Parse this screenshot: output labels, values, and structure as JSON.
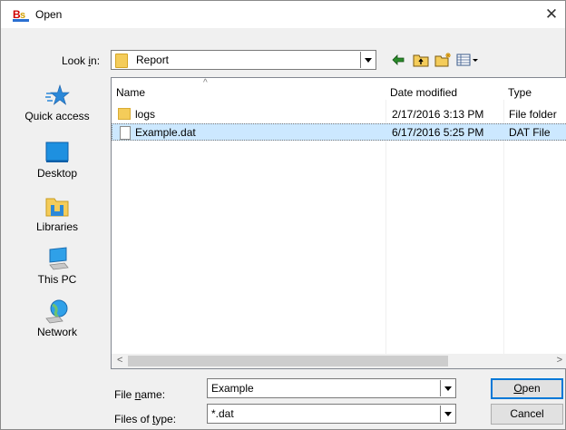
{
  "window": {
    "title": "Open",
    "close_glyph": "✕"
  },
  "lookin": {
    "label_pre": "Look ",
    "label_key": "i",
    "label_post": "n:",
    "value": "Report"
  },
  "toolbar": {
    "icons": [
      "back-arrow-icon",
      "up-folder-icon",
      "new-folder-icon",
      "view-menu-icon"
    ]
  },
  "places": [
    {
      "label": "Quick access",
      "icon": "star-icon"
    },
    {
      "label": "Desktop",
      "icon": "desktop-icon"
    },
    {
      "label": "Libraries",
      "icon": "libraries-icon"
    },
    {
      "label": "This PC",
      "icon": "computer-icon"
    },
    {
      "label": "Network",
      "icon": "network-icon"
    }
  ],
  "columns": {
    "name": "Name",
    "date": "Date modified",
    "type": "Type"
  },
  "files": [
    {
      "name": "logs",
      "date": "2/17/2016 3:13 PM",
      "type": "File folder",
      "icon": "folder-icon",
      "selected": false
    },
    {
      "name": "Example.dat",
      "date": "6/17/2016 5:25 PM",
      "type": "DAT File",
      "icon": "file-icon",
      "selected": true
    }
  ],
  "scroll": {
    "left_glyph": "<",
    "right_glyph": ">"
  },
  "filename": {
    "label_pre": "File ",
    "label_key": "n",
    "label_post": "ame:",
    "value": "Example"
  },
  "filetype": {
    "label_pre": "Files of ",
    "label_key": "t",
    "label_post": "ype:",
    "value": "*.dat"
  },
  "buttons": {
    "open_key": "O",
    "open_rest": "pen",
    "cancel": "Cancel"
  },
  "colors": {
    "selection": "#cce8ff",
    "accent": "#0078d7",
    "folder": "#f4cc5a"
  }
}
